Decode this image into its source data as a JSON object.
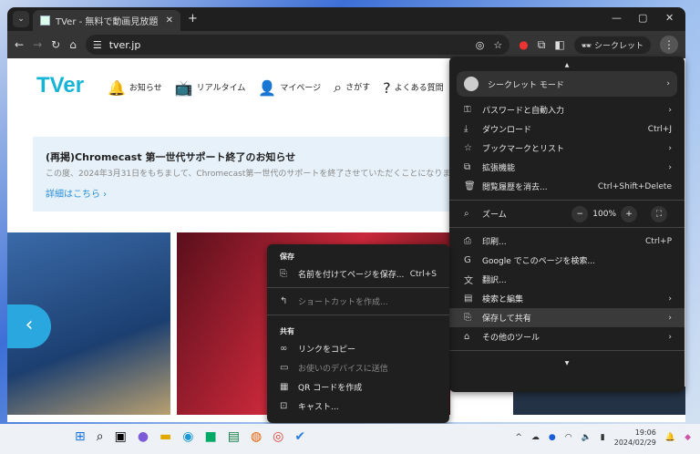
{
  "browser": {
    "tab_title": "TVer - 無料で動画見放題",
    "url": "tver.jp",
    "incognito_label": "シークレット"
  },
  "site": {
    "logo": "TVer",
    "nav": [
      {
        "icon": "bell-icon",
        "glyph": "🔔",
        "label": "お知らせ"
      },
      {
        "icon": "tv-icon",
        "glyph": "📺",
        "label": "リアルタイム"
      },
      {
        "icon": "user-icon",
        "glyph": "👤",
        "label": "マイページ"
      },
      {
        "icon": "search-icon",
        "glyph": "⌕",
        "label": "さがす"
      },
      {
        "icon": "help-icon",
        "glyph": "?",
        "label": "よくある質問"
      }
    ],
    "notice": {
      "title": "(再掲)Chromecast 第一世代サポート終了のお知らせ",
      "body": "この度、2024年3月31日をもちまして、Chromecast第一世代のサポートを終了させていただくことになりま",
      "link": "詳細はこちら ›"
    }
  },
  "menu": {
    "incognito": "シークレット モード",
    "items1": [
      {
        "icon": "key-icon",
        "g": "⚿",
        "label": "パスワードと自動入力",
        "sc": "›"
      },
      {
        "icon": "download-icon",
        "g": "⤓",
        "label": "ダウンロード",
        "sc": "Ctrl+J"
      },
      {
        "icon": "star-icon",
        "g": "☆",
        "label": "ブックマークとリスト",
        "sc": "›"
      },
      {
        "icon": "extension-icon",
        "g": "⧉",
        "label": "拡張機能",
        "sc": "›"
      },
      {
        "icon": "trash-icon",
        "g": "🗑",
        "label": "閲覧履歴を消去...",
        "sc": "Ctrl+Shift+Delete"
      }
    ],
    "zoom": {
      "label": "ズーム",
      "value": "100%",
      "minus": "−",
      "plus": "+",
      "full": "⛶"
    },
    "items2": [
      {
        "icon": "print-icon",
        "g": "⎙",
        "label": "印刷...",
        "sc": "Ctrl+P"
      },
      {
        "icon": "google-icon",
        "g": "G",
        "label": "Google でこのページを検索...",
        "sc": ""
      },
      {
        "icon": "translate-icon",
        "g": "文",
        "label": "翻訳...",
        "sc": ""
      },
      {
        "icon": "find-edit-icon",
        "g": "▤",
        "label": "検索と編集",
        "sc": "›"
      },
      {
        "icon": "save-share-icon",
        "g": "⎘",
        "label": "保存して共有",
        "sc": "›"
      },
      {
        "icon": "toolbox-icon",
        "g": "⌂",
        "label": "その他のツール",
        "sc": "›"
      }
    ]
  },
  "submenu": {
    "save_header": "保存",
    "save_page": "名前を付けてページを保存...",
    "save_sc": "Ctrl+S",
    "shortcut": "ショートカットを作成...",
    "share_header": "共有",
    "copy_link": "リンクをコピー",
    "send_device": "お使いのデバイスに送信",
    "qr": "QR コードを作成",
    "cast": "キャスト..."
  },
  "taskbar": {
    "time": "19:06",
    "date": "2024/02/29"
  }
}
